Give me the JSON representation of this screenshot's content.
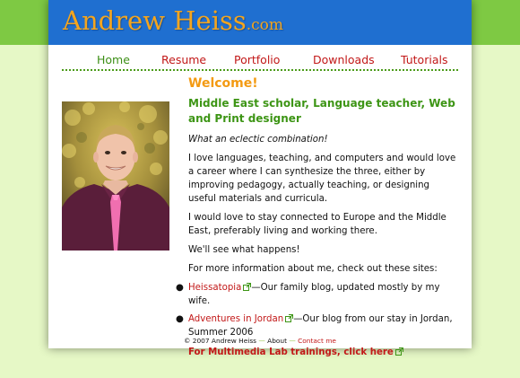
{
  "site": {
    "logo_name": "Andrew Heiss",
    "logo_tld": ".com"
  },
  "nav": {
    "items": [
      "Home",
      "Resume",
      "Portfolio",
      "Downloads",
      "Tutorials"
    ]
  },
  "main": {
    "welcome": "Welcome!",
    "tagline": "Middle East scholar, Language teacher, Web and Print designer",
    "eclectic": "What an eclectic combination!",
    "para1": "I love languages, teaching, and computers and would love a career where I can synthesize the three, either by improving pedagogy, actually teaching, or designing useful materials and curricula.",
    "para2": "I would love to stay connected to Europe and the Middle East, preferably living and working there.",
    "para3": "We'll see what happens!",
    "para4": "For more information about me, check out these sites:",
    "links": [
      {
        "label": "Heissatopia",
        "desc": "—Our family blog, updated mostly by my wife."
      },
      {
        "label": "Adventures in Jordan",
        "desc": "—Our blog from our stay in Jordan, Summer 2006"
      }
    ],
    "ml_link": "For Multimedia Lab trainings, click here"
  },
  "footer": {
    "copyright": "© 2007 Andrew Heiss",
    "sep": " — ",
    "about": "About",
    "contact": "Contact me"
  },
  "colors": {
    "header_blue": "#1f6fd0",
    "green_band": "#7ec943",
    "background": "#e6f8c6",
    "logo_orange": "#f4a51e",
    "link_red": "#c21818",
    "nav_green": "#3c8f16"
  },
  "icons": [
    "external-link-icon"
  ]
}
